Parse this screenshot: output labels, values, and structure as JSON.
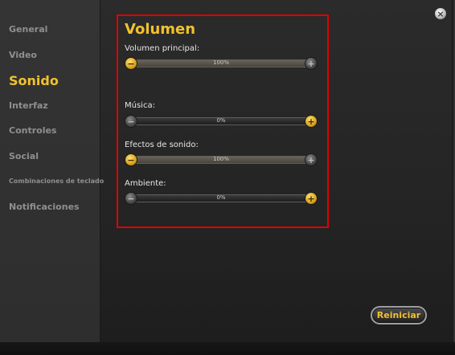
{
  "sidebar": {
    "items": [
      {
        "label": "General",
        "active": false
      },
      {
        "label": "Video",
        "active": false
      },
      {
        "label": "Sonido",
        "active": true
      },
      {
        "label": "Interfaz",
        "active": false
      },
      {
        "label": "Controles",
        "active": false
      },
      {
        "label": "Social",
        "active": false
      },
      {
        "label": "Combinaciones de teclado",
        "active": false
      },
      {
        "label": "Notificaciones",
        "active": false
      }
    ]
  },
  "section": {
    "title": "Volumen",
    "sliders": [
      {
        "label": "Volumen principal:",
        "value_text": "100%",
        "level": 1.0
      },
      {
        "label": "Música:",
        "value_text": "0%",
        "level": 0.0
      },
      {
        "label": "Efectos de sonido:",
        "value_text": "100%",
        "level": 1.0
      },
      {
        "label": "Ambiente:",
        "value_text": "0%",
        "level": 0.0
      }
    ],
    "minus_glyph": "−",
    "plus_glyph": "+"
  },
  "buttons": {
    "close_glyph": "×",
    "reset_label": "Reiniciar"
  },
  "colors": {
    "accent": "#f2c12e",
    "highlight_box": "#e10000",
    "inactive_text": "#8f8f8f"
  },
  "icons": {
    "close": "close-icon",
    "minus": "minus-icon",
    "plus": "plus-icon"
  }
}
